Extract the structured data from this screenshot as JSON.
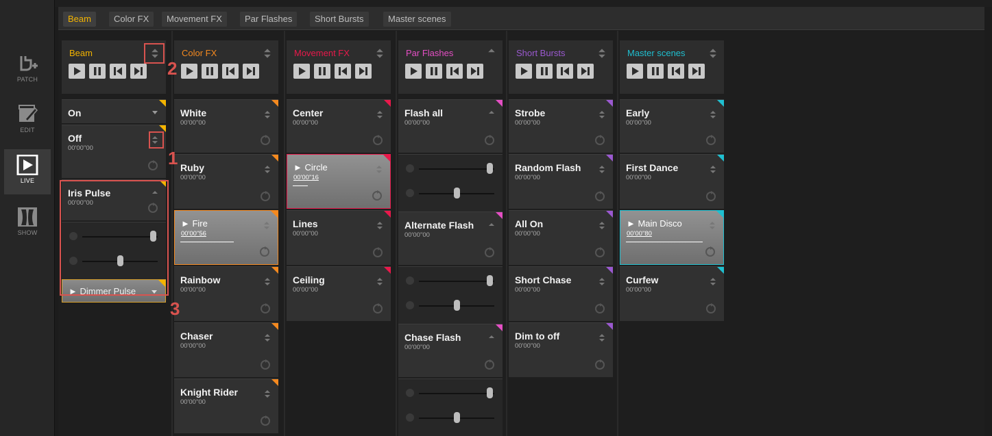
{
  "sidebar": {
    "modes": [
      {
        "label": "PATCH",
        "icon": "patch-icon"
      },
      {
        "label": "EDIT",
        "icon": "edit-icon"
      },
      {
        "label": "LIVE",
        "icon": "live-icon"
      },
      {
        "label": "SHOW",
        "icon": "show-icon"
      }
    ]
  },
  "tabs": [
    "Beam",
    "Color FX",
    "Movement FX",
    "Par Flashes",
    "Short Bursts",
    "Master scenes"
  ],
  "columns": [
    {
      "title": "Beam",
      "color": "#f4b400",
      "cues": [
        {
          "name": "On",
          "time": ""
        },
        {
          "name": "Off",
          "time": "00'00\"00"
        },
        {
          "name": "Iris Pulse",
          "time": "00'00\"00"
        },
        {
          "name": "► Dimmer Pulse",
          "time": ""
        }
      ]
    },
    {
      "title": "Color FX",
      "color": "#f4891f",
      "cues": [
        {
          "name": "White",
          "time": "00'00\"00"
        },
        {
          "name": "Ruby",
          "time": "00'00\"00"
        },
        {
          "name": "► Fire",
          "time": "00'00\"56"
        },
        {
          "name": "Rainbow",
          "time": "00'00\"00"
        },
        {
          "name": "Chaser",
          "time": "00'00\"00"
        },
        {
          "name": "Knight Rider",
          "time": "00'00\"00"
        }
      ]
    },
    {
      "title": "Movement FX",
      "color": "#e8194b",
      "cues": [
        {
          "name": "Center",
          "time": "00'00\"00"
        },
        {
          "name": "► Circle",
          "time": "00'00\"16"
        },
        {
          "name": "Lines",
          "time": "00'00\"00"
        },
        {
          "name": "Ceiling",
          "time": "00'00\"00"
        }
      ]
    },
    {
      "title": "Par Flashes",
      "color": "#e44fc4",
      "cues": [
        {
          "name": "Flash all",
          "time": "00'00\"00"
        },
        {
          "name": "Alternate Flash",
          "time": "00'00\"00"
        },
        {
          "name": "Chase Flash",
          "time": "00'00\"00"
        }
      ]
    },
    {
      "title": "Short Bursts",
      "color": "#9b59d0",
      "cues": [
        {
          "name": "Strobe",
          "time": "00'00\"00"
        },
        {
          "name": "Random Flash",
          "time": "00'00\"00"
        },
        {
          "name": "All On",
          "time": "00'00\"00"
        },
        {
          "name": "Short Chase",
          "time": "00'00\"00"
        },
        {
          "name": "Dim to off",
          "time": "00'00\"00"
        }
      ]
    },
    {
      "title": "Master scenes",
      "color": "#1fbfd0",
      "cues": [
        {
          "name": "Early",
          "time": "00'00\"00"
        },
        {
          "name": "First Dance",
          "time": "00'00\"00"
        },
        {
          "name": "► Main Disco",
          "time": "00'00\"80"
        },
        {
          "name": "Curfew",
          "time": "00'00\"00"
        }
      ]
    }
  ],
  "progress": {
    "fire": 0.57,
    "circle": 0.16,
    "main_disco": 0.82
  },
  "slider_levels": {
    "level": 0.98,
    "speed": 0.5
  },
  "callouts": [
    "1",
    "2",
    "3"
  ]
}
